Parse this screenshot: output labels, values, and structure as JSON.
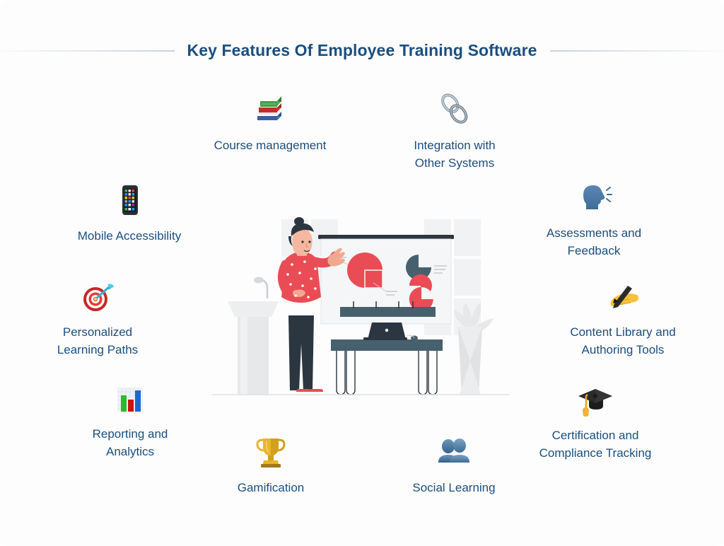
{
  "page": {
    "title": "Key Features Of Employee Training Software",
    "background_color": "#fdfdfd",
    "accent_color": "#1b4e7f",
    "rule_color": "#c5d3e0"
  },
  "features": [
    {
      "id": "course",
      "label": "Course management",
      "icon": "books-icon"
    },
    {
      "id": "integration",
      "label": "Integration with\nOther Systems",
      "icon": "chain-link-icon"
    },
    {
      "id": "mobile",
      "label": "Mobile Accessibility",
      "icon": "mobile-phone-icon"
    },
    {
      "id": "personal",
      "label": "Personalized\nLearning Paths",
      "icon": "dart-target-icon"
    },
    {
      "id": "reporting",
      "label": "Reporting and\nAnalytics",
      "icon": "bar-chart-icon"
    },
    {
      "id": "assess",
      "label": "Assessments and\nFeedback",
      "icon": "speaking-head-icon"
    },
    {
      "id": "content",
      "label": "Content Library and\nAuthoring Tools",
      "icon": "writing-hand-icon"
    },
    {
      "id": "certif",
      "label": "Certification and\nCompliance Tracking",
      "icon": "graduation-cap-icon"
    },
    {
      "id": "gamif",
      "label": "Gamification",
      "icon": "trophy-icon"
    },
    {
      "id": "social",
      "label": "Social Learning",
      "icon": "busts-in-silhouette-icon"
    }
  ],
  "illustration": {
    "name": "presentation-scene",
    "description": "Presenter beside a whiteboard with pie charts, podium with microphone, desk with laptop and a potted plant",
    "colors": {
      "red": "#ea4c55",
      "navy": "#47606e",
      "dark": "#2b3640",
      "light_grey": "#eceef0",
      "skin": "#f0a990"
    }
  }
}
